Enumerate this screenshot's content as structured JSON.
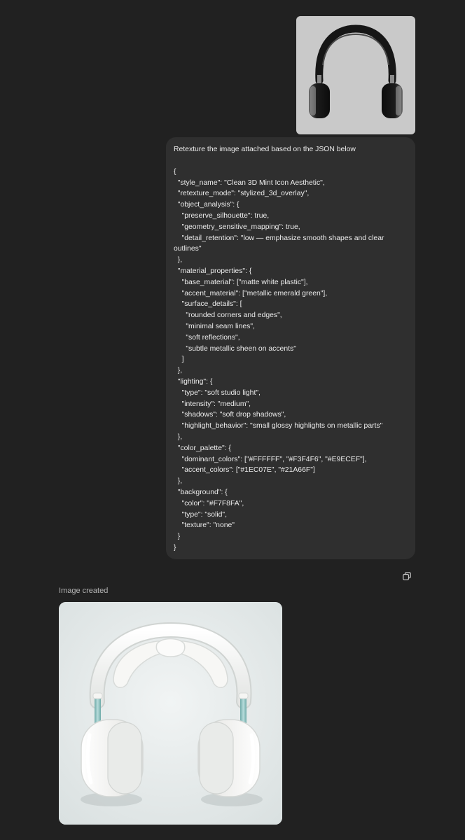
{
  "conversation": {
    "user_message": {
      "attachment": {
        "icon": "headphones-reference-image",
        "colors": {
          "background": "#c9c9c9",
          "headphones": "#1a1a1a"
        }
      },
      "intro_text": "Retexture the image attached based on the JSON below",
      "json_text": "{\n  \"style_name\": \"Clean 3D Mint Icon Aesthetic\",\n  \"retexture_mode\": \"stylized_3d_overlay\",\n  \"object_analysis\": {\n    \"preserve_silhouette\": true,\n    \"geometry_sensitive_mapping\": true,\n    \"detail_retention\": \"low — emphasize smooth shapes and clear outlines\"\n  },\n  \"material_properties\": {\n    \"base_material\": [\"matte white plastic\"],\n    \"accent_material\": [\"metallic emerald green\"],\n    \"surface_details\": [\n      \"rounded corners and edges\",\n      \"minimal seam lines\",\n      \"soft reflections\",\n      \"subtle metallic sheen on accents\"\n    ]\n  },\n  \"lighting\": {\n    \"type\": \"soft studio light\",\n    \"intensity\": \"medium\",\n    \"shadows\": \"soft drop shadows\",\n    \"highlight_behavior\": \"small glossy highlights on metallic parts\"\n  },\n  \"color_palette\": {\n    \"dominant_colors\": [\"#FFFFFF\", \"#F3F4F6\", \"#E9ECEF\"],\n    \"accent_colors\": [\"#1EC07E\", \"#21A66F\"]\n  },\n  \"background\": {\n    \"color\": \"#F7F8FA\",\n    \"type\": \"solid\",\n    \"texture\": \"none\"\n  }\n}"
    },
    "actions": {
      "copy_icon": "copy-icon"
    },
    "assistant_message": {
      "status": "Image created",
      "image": {
        "icon": "white-headphones-generated-image",
        "colors": {
          "background": "#e7ecec",
          "body": "#f4f4f2",
          "accent": "#8fc3c2"
        }
      }
    }
  },
  "theme": {
    "page_background": "#212121",
    "bubble_background": "#2f2f2f",
    "text_color": "#ececec",
    "muted_text": "#b4b4b4"
  }
}
